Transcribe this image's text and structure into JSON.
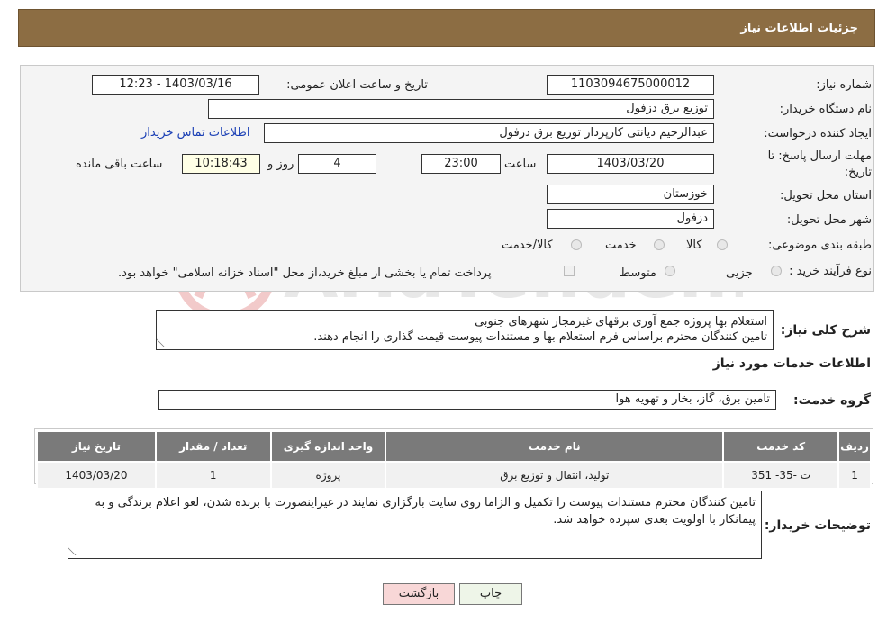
{
  "header": {
    "title": "جزئیات اطلاعات نیاز"
  },
  "fields": {
    "need_number_label": "شماره نیاز:",
    "need_number": "1103094675000012",
    "announce_label": "تاریخ و ساعت اعلان عمومی:",
    "announce_value": "1403/03/16 - 12:23",
    "buyer_org_label": "نام دستگاه خریدار:",
    "buyer_org": "توزیع برق دزفول",
    "creator_label": "ایجاد کننده درخواست:",
    "creator": "عبدالرحیم دیانتی کارپرداز توزیع برق دزفول",
    "contact_link": "اطلاعات تماس خریدار",
    "deadline_label_1": "مهلت ارسال پاسخ: تا",
    "deadline_label_2": "تاریخ:",
    "deadline_date": "1403/03/20",
    "time_label": "ساعت",
    "deadline_time": "23:00",
    "days_value": "4",
    "days_label": "روز و",
    "remaining_time": "10:18:43",
    "remaining_label": "ساعت باقی مانده",
    "province_label": "استان محل تحویل:",
    "province": "خوزستان",
    "city_label": "شهر محل تحویل:",
    "city": "دزفول",
    "category_label": "طبقه بندی موضوعی:",
    "category_options": [
      "کالا",
      "خدمت",
      "کالا/خدمت"
    ],
    "process_label": "نوع فرآیند خرید :",
    "process_options": [
      "جزیی",
      "متوسط"
    ],
    "payment_note": "پرداخت تمام یا بخشی از مبلغ خرید،از محل \"اسناد خزانه اسلامی\" خواهد بود."
  },
  "description": {
    "label": "شرح کلی نیاز:",
    "lines": [
      "استعلام بها پروژه جمع آوری برقهای غیرمجاز شهرهای جنوبی",
      "تامین کنندگان محترم براساس فرم استعلام بها و مستندات پیوست قیمت گذاری را انجام دهند."
    ]
  },
  "services": {
    "section_title": "اطلاعات خدمات مورد نیاز",
    "group_label": "گروه خدمت:",
    "group_value": "تامین برق، گاز، بخار و تهویه هوا",
    "columns": [
      "ردیف",
      "کد خدمت",
      "نام خدمت",
      "واحد اندازه گیری",
      "تعداد / مقدار",
      "تاریخ نیاز"
    ],
    "rows": [
      [
        "1",
        "ت -35- 351",
        "تولید، انتقال و توزیع برق",
        "پروژه",
        "1",
        "1403/03/20"
      ]
    ]
  },
  "buyer_notes": {
    "label": "توضیحات خریدار:",
    "text": "تامین کنندگان محترم مستندات پیوست را تکمیل و الزاما روی سایت بارگزاری نمایند در غیراینصورت با برنده شدن، لغو اعلام برندگی و به پیمانکار با اولویت بعدی سپرده خواهد شد."
  },
  "buttons": {
    "print": "چاپ",
    "back": "بازگشت"
  },
  "watermark": {
    "text": "AriaTender.net"
  },
  "colors": {
    "header": "#8c6d43",
    "table_header": "#7a7a7a",
    "back_button": "#f8d7d7",
    "print_button": "#eef5e8",
    "link": "#1a3fb5"
  }
}
